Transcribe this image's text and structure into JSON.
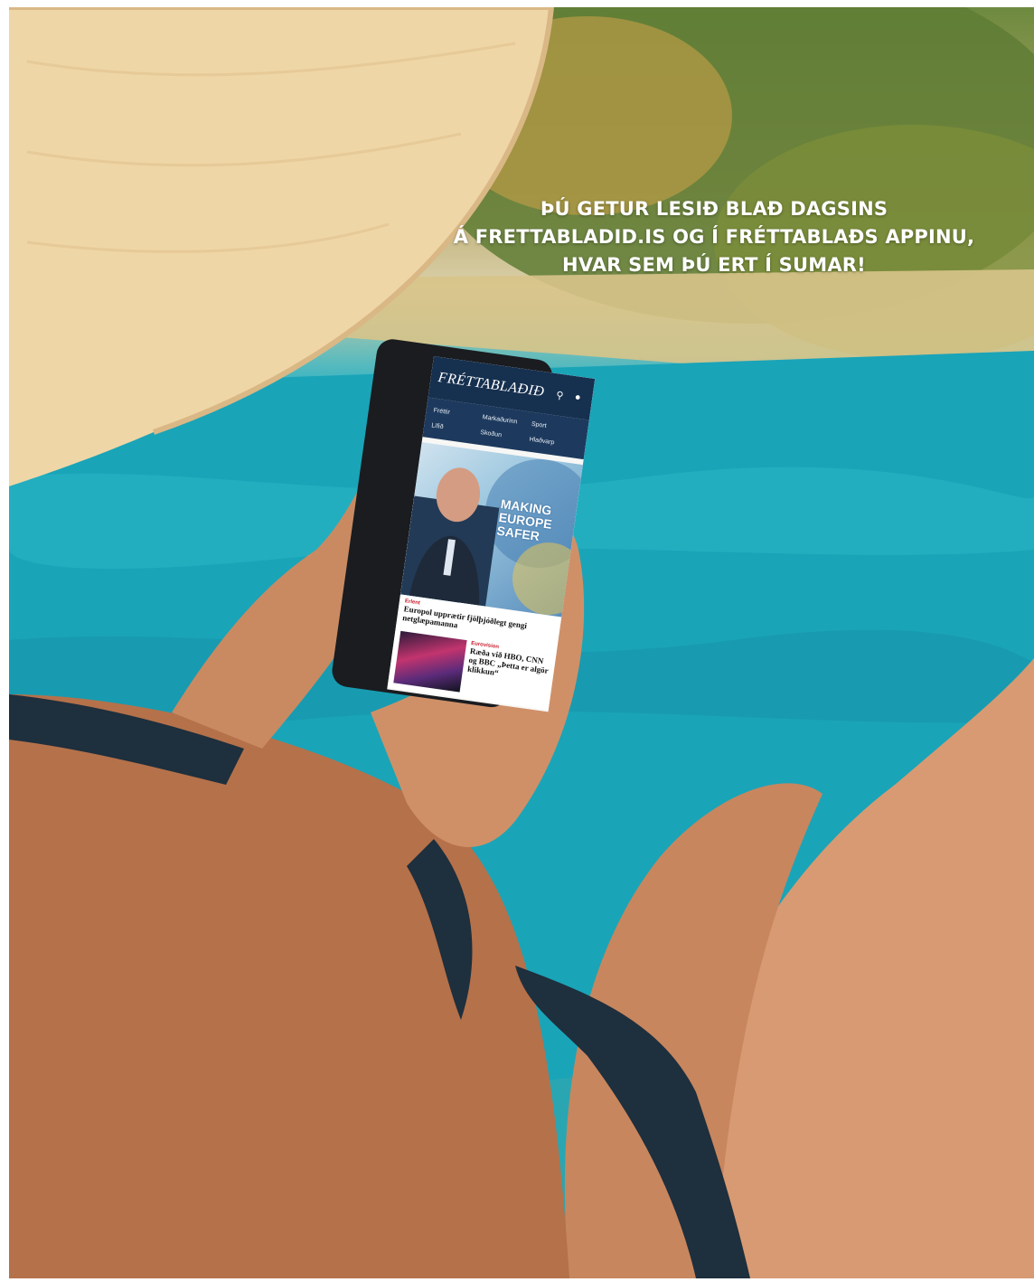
{
  "caption": {
    "line1": "ÞÚ GETUR LESIÐ BLAÐ DAGSINS",
    "line2": "Á FRETTABLADID.IS OG Í FRÉTTABLAÐS APPINU,",
    "line3": "HVAR SEM ÞÚ ERT Í SUMAR!"
  },
  "app": {
    "logo": "FRÉTTABLAÐIÐ",
    "icons": [
      "search-icon",
      "user-icon"
    ],
    "nav": [
      "Fréttir",
      "Markaðurinn",
      "Sport",
      "Lífið",
      "Skoðun",
      "Hlaðvarp"
    ],
    "hero_text": [
      "MAKING",
      "EUROPE",
      "SAFER"
    ],
    "article1": {
      "tag": "Erlent",
      "headline": "Europol upprætir fjölþjóðlegt gengi netglæpamanna"
    },
    "article2": {
      "tag": "Eurovision",
      "headline": "Ræða við HBO, CNN og BBC „Þetta er algör klikkun“"
    }
  },
  "colors": {
    "app_header": "#16304f",
    "app_nav": "#1d3a5e",
    "tag_red": "#c8202e",
    "pool": "#1fa7bb"
  }
}
